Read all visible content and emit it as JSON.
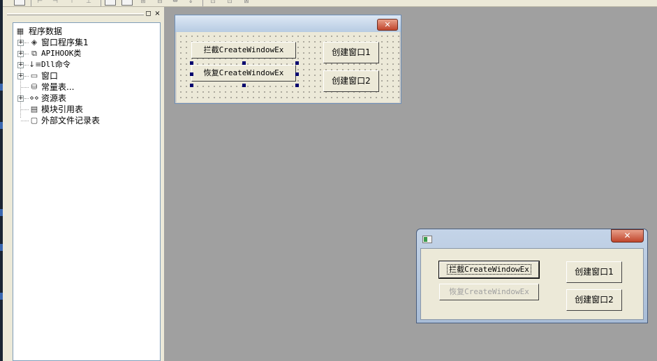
{
  "colors": {
    "workspace": "#a0a0a0",
    "panel": "#ece9d8",
    "selection_handle": "#00006e",
    "close_button": "#c0452c"
  },
  "tree": {
    "root_label": "程序数据",
    "items": [
      {
        "label": "窗口程序集1",
        "icon": "stack-icon",
        "expandable": true
      },
      {
        "label": "APIHOOK类",
        "icon": "class-icon",
        "expandable": true
      },
      {
        "label": "Dll命令",
        "icon": "dll-icon",
        "expandable": true
      },
      {
        "label": "窗口",
        "icon": "window-icon",
        "expandable": true
      },
      {
        "label": "常量表...",
        "icon": "constant-icon",
        "expandable": false
      },
      {
        "label": "资源表",
        "icon": "resource-icon",
        "expandable": true
      },
      {
        "label": "模块引用表",
        "icon": "module-icon",
        "expandable": false
      },
      {
        "label": "外部文件记录表",
        "icon": "file-icon",
        "expandable": false
      }
    ]
  },
  "panel_buttons": {
    "restore": "◻",
    "close": "×"
  },
  "design_form": {
    "close_glyph": "✕",
    "buttons": {
      "intercept": "拦截CreateWindowEx",
      "restore": "恢复CreateWindowEx",
      "create1": "创建窗口1",
      "create2": "创建窗口2"
    }
  },
  "run_form": {
    "close_glyph": "✕",
    "buttons": {
      "intercept": "拦截CreateWindowEx",
      "restore": "恢复CreateWindowEx",
      "create1": "创建窗口1",
      "create2": "创建窗口2"
    }
  }
}
